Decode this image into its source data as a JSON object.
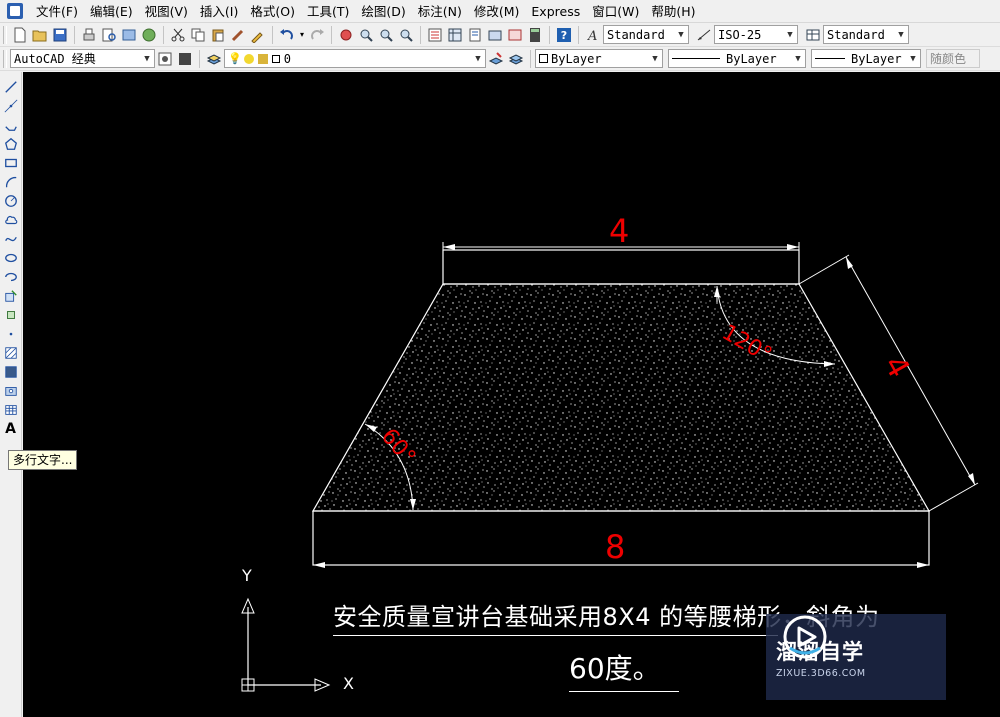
{
  "menu": [
    "文件(F)",
    "编辑(E)",
    "视图(V)",
    "插入(I)",
    "格式(O)",
    "工具(T)",
    "绘图(D)",
    "标注(N)",
    "修改(M)",
    "Express",
    "窗口(W)",
    "帮助(H)"
  ],
  "toolbar1": {
    "text_style": "Standard",
    "dim_style": "ISO-25",
    "table_style": "Standard"
  },
  "toolbar2": {
    "workspace": "AutoCAD 经典",
    "layer": "0",
    "color": "ByLayer",
    "linetype": "ByLayer",
    "lineweight": "ByLayer",
    "plot_style": "随颜色"
  },
  "tooltip": "多行文字...",
  "drawing": {
    "dim_top": "4",
    "dim_right": "4",
    "dim_bottom": "8",
    "angle_left": "60°",
    "angle_right": "120°",
    "ucs_y": "Y",
    "ucs_x": "X",
    "note_line1": "安全质量宣讲台基础采用8X4 的等腰梯形，斜角为",
    "note_line2": "60度。"
  },
  "watermark": {
    "title": "溜溜自学",
    "subtitle": "ZIXUE.3D66.COM"
  },
  "colors": {
    "canvas": "#000000",
    "dimension": "#ff0000",
    "geometry": "#ffffff"
  }
}
